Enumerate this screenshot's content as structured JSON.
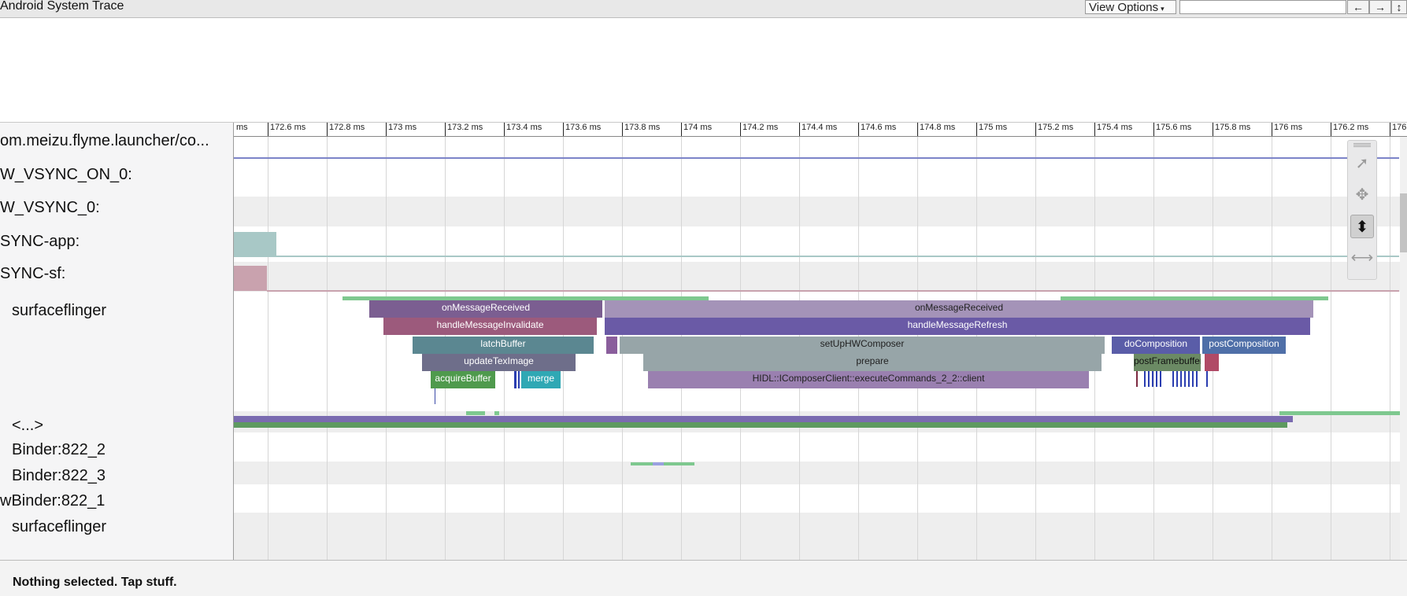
{
  "app": {
    "title": "Android System Trace"
  },
  "toolbar": {
    "view_options_label": "View Options",
    "view_options_caret": "▾",
    "search_value": "",
    "back_label": "←",
    "forward_label": "→",
    "more_label": "↕"
  },
  "ruler": {
    "ticks": [
      "ms",
      "172.6 ms",
      "172.8 ms",
      "173 ms",
      "173.2 ms",
      "173.4 ms",
      "173.6 ms",
      "173.8 ms",
      "174 ms",
      "174.2 ms",
      "174.4 ms",
      "174.6 ms",
      "174.8 ms",
      "175 ms",
      "175.2 ms",
      "175.4 ms",
      "175.6 ms",
      "175.8 ms",
      "176 ms",
      "176.2 ms",
      "176"
    ]
  },
  "tracks": [
    "om.meizu.flyme.launcher/co...",
    "W_VSYNC_ON_0:",
    "W_VSYNC_0:",
    "SYNC-app:",
    "SYNC-sf:",
    "surfaceflinger",
    "<...>",
    "Binder:822_2",
    "Binder:822_3",
    "wBinder:822_1",
    "surfaceflinger"
  ],
  "slices": {
    "onMessageReceived_1": "onMessageReceived",
    "handleMessageInvalidate": "handleMessageInvalidate",
    "latchBuffer": "latchBuffer",
    "updateTexImage": "updateTexImage",
    "acquireBuffer": "acquireBuffer",
    "merge": "merge",
    "onMessageReceived_2": "onMessageReceived",
    "handleMessageRefresh": "handleMessageRefresh",
    "setUpHWComposer": "setUpHWComposer",
    "prepare": "prepare",
    "executeCommands": "HIDL::IComposerClient::executeCommands_2_2::client",
    "doComposition": "doComposition",
    "postComposition": "postComposition",
    "postFramebuffer": "postFramebuffer"
  },
  "colors": {
    "onMessageReceived": "#7b5e91",
    "handleMessageInvalidate": "#9c5a7c",
    "latchBuffer": "#5b8791",
    "acquireBuffer": "#4f9a4d",
    "merge": "#2fa8b4",
    "handleMessageRefresh": "#6a5aa6",
    "doComposition": "#5a5da8",
    "postComposition": "#4f6fa8",
    "postFramebuffer": "#6b8a64"
  },
  "nav_tools": [
    "select-tool",
    "pan-tool",
    "zoom-tool",
    "timing-tool"
  ],
  "status": {
    "text": "Nothing selected. Tap stuff."
  }
}
